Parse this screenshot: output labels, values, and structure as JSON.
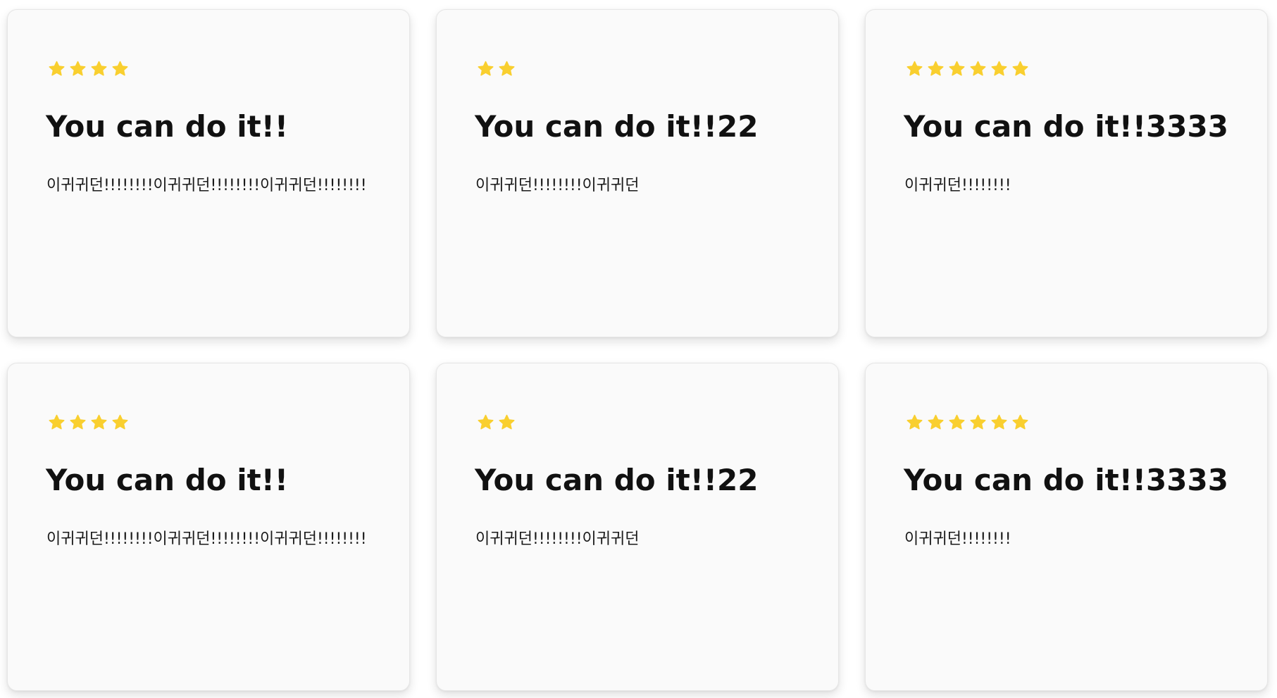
{
  "colors": {
    "star": "#F9CF2F",
    "card_background": "#FAFAFA",
    "title": "#111111",
    "text": "#1A1A1A"
  },
  "cards": [
    {
      "rating": 4,
      "title": "You can do it!!",
      "text": "이귀귀던!!!!!!!!이귀귀던!!!!!!!!이귀귀던!!!!!!!!"
    },
    {
      "rating": 2,
      "title": "You can do it!!22",
      "text": "이귀귀던!!!!!!!!이귀귀던"
    },
    {
      "rating": 6,
      "title": "You can do it!!3333",
      "text": "이귀귀던!!!!!!!!"
    },
    {
      "rating": 4,
      "title": "You can do it!!",
      "text": "이귀귀던!!!!!!!!이귀귀던!!!!!!!!이귀귀던!!!!!!!!"
    },
    {
      "rating": 2,
      "title": "You can do it!!22",
      "text": "이귀귀던!!!!!!!!이귀귀던"
    },
    {
      "rating": 6,
      "title": "You can do it!!3333",
      "text": "이귀귀던!!!!!!!!"
    }
  ]
}
